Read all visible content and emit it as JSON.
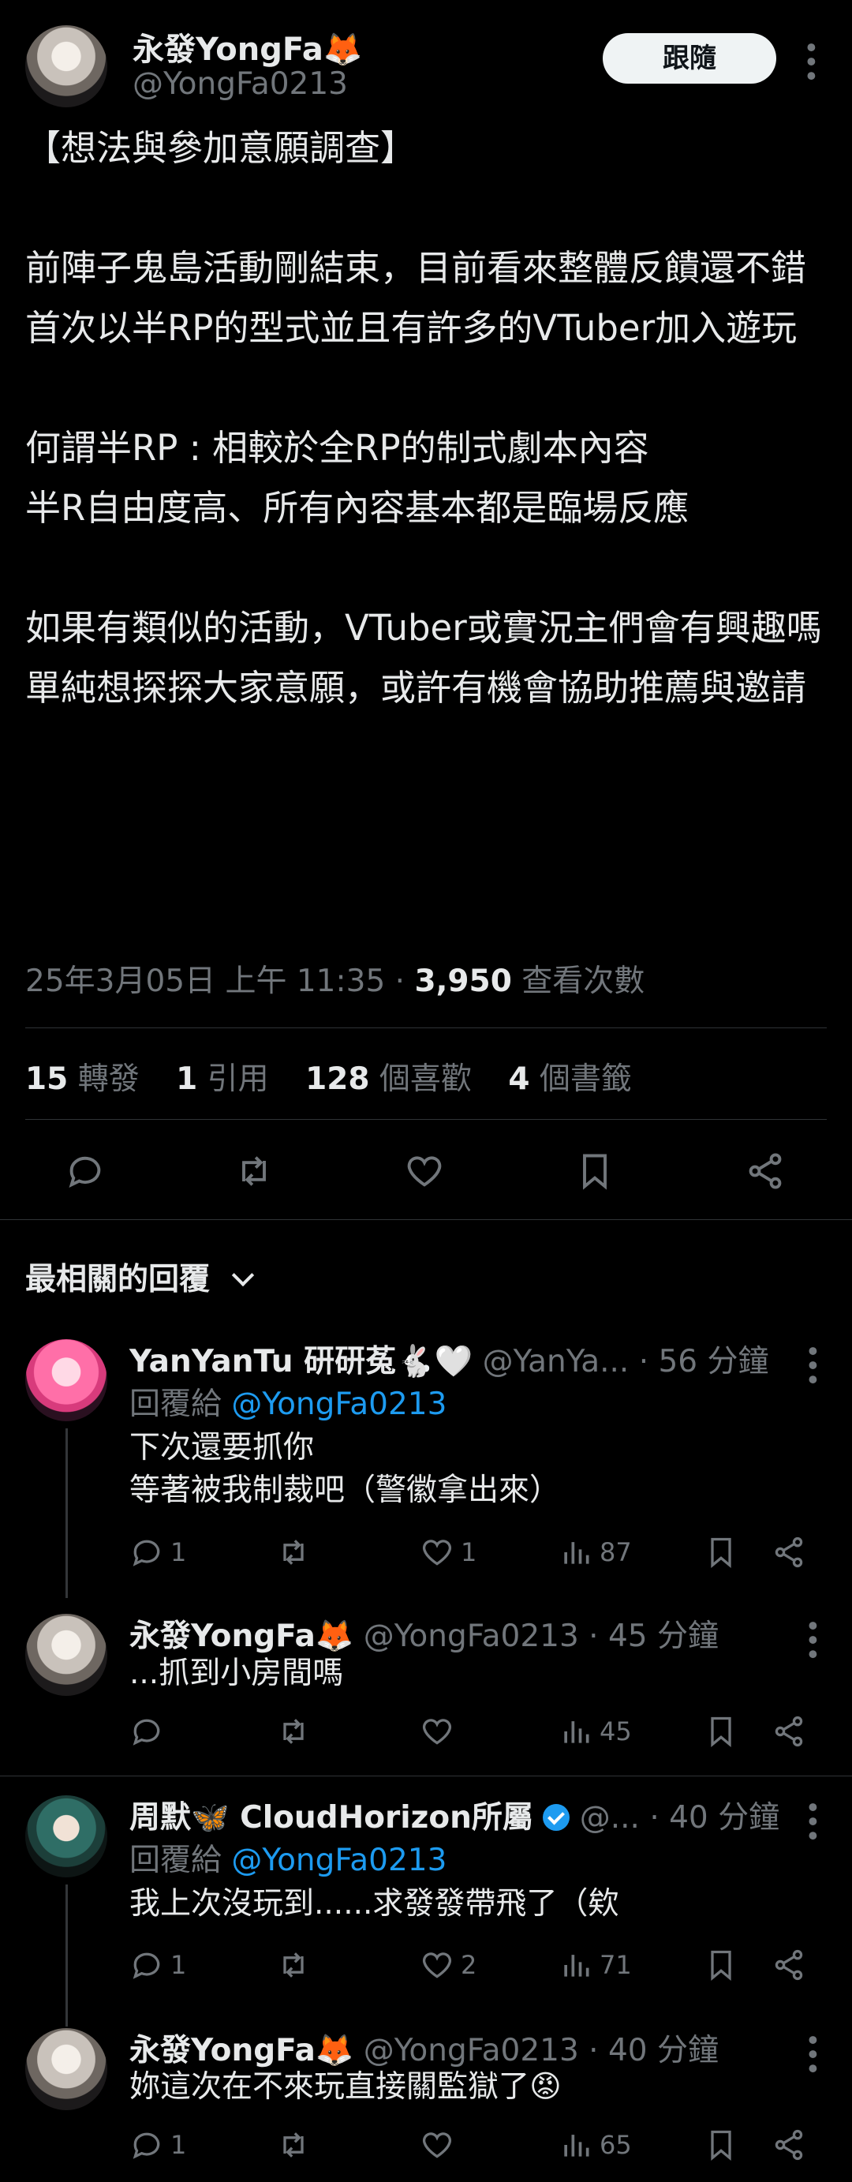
{
  "post": {
    "author_name": "永發YongFa🦊",
    "author_handle": "@YongFa0213",
    "follow_label": "跟隨",
    "body": "【想法與參加意願調查】\n\n前陣子鬼島活動剛結束，目前看來整體反饋還不錯\n首次以半RP的型式並且有許多的VTuber加入遊玩\n\n何謂半RP : 相較於全RP的制式劇本內容\n半R自由度高、所有內容基本都是臨場反應\n\n如果有類似的活動，VTuber或實況主們會有興趣嗎\n單純想探探大家意願，或許有機會協助推薦與邀請",
    "timestamp": "25年3月05日 上午 11:35",
    "views_count": "3,950",
    "views_label": "查看次數",
    "retweets_count": "15",
    "retweets_label": "轉發",
    "quotes_count": "1",
    "quotes_label": "引用",
    "likes_count": "128",
    "likes_label": "個喜歡",
    "bookmarks_count": "4",
    "bookmarks_label": "個書籤"
  },
  "sort": {
    "label": "最相關的回覆"
  },
  "replies": [
    {
      "name": "YanYanTu 研研菟🐇🤍",
      "handle": "@YanYa...",
      "time": "· 56 分鐘",
      "reply_to_label": "回覆給",
      "reply_to_handle": "@YongFa0213",
      "text": "下次還要抓你\n等著被我制裁吧（警徽拿出來）",
      "replies": "1",
      "retweets": "",
      "likes": "1",
      "views": "87"
    },
    {
      "name": "永發YongFa🦊",
      "handle": "@YongFa0213",
      "time": "· 45 分鐘",
      "text": "...抓到小房間嗎",
      "replies": "",
      "retweets": "",
      "likes": "",
      "views": "45"
    },
    {
      "name": "周默🦋 CloudHorizon所屬",
      "handle": "@...",
      "time": "· 40 分鐘",
      "reply_to_label": "回覆給",
      "reply_to_handle": "@YongFa0213",
      "text": "我上次沒玩到......求發發帶飛了（欸",
      "replies": "1",
      "retweets": "",
      "likes": "2",
      "views": "71"
    },
    {
      "name": "永發YongFa🦊",
      "handle": "@YongFa0213",
      "time": "· 40 分鐘",
      "text": "妳這次在不來玩直接關監獄了😡",
      "replies": "1",
      "retweets": "",
      "likes": "",
      "views": "65"
    }
  ]
}
